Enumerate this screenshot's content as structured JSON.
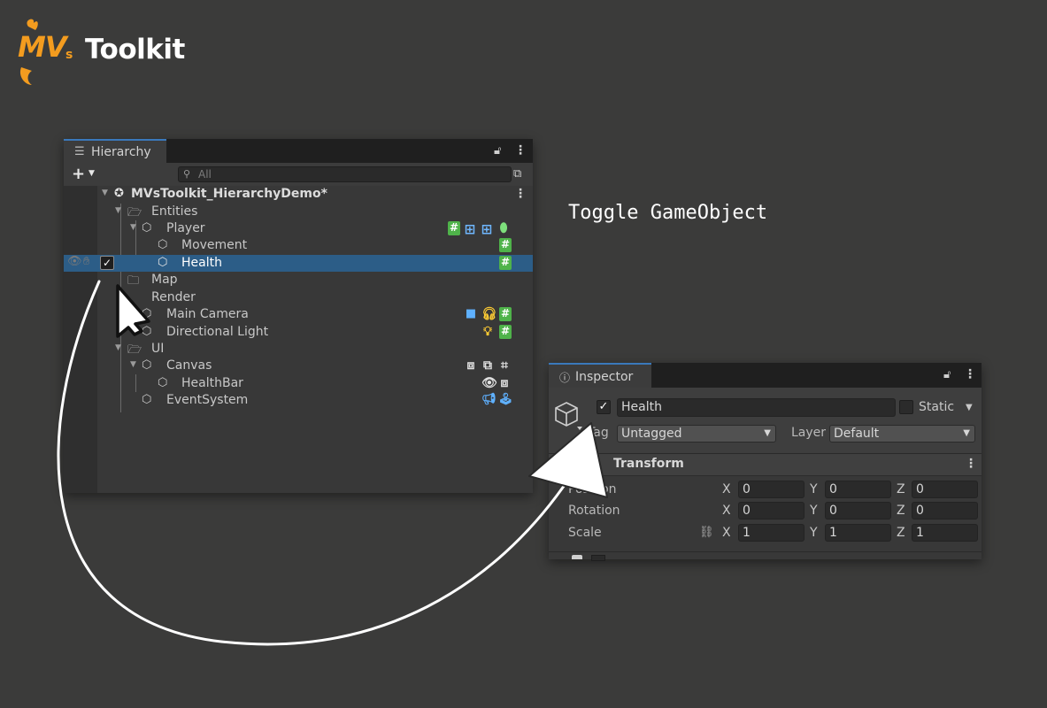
{
  "logo": {
    "mvs": "MV",
    "s": "s",
    "toolkit": "Toolkit"
  },
  "caption": "Toggle GameObject",
  "hierarchy": {
    "tab_label": "Hierarchy",
    "search_placeholder": "All",
    "scene": "MVsToolkit_HierarchyDemo*",
    "rows": {
      "entities": "Entities",
      "player": "Player",
      "movement": "Movement",
      "health": "Health",
      "map": "Map",
      "render": "Render",
      "main_camera": "Main Camera",
      "directional_light": "Directional Light",
      "ui": "UI",
      "canvas": "Canvas",
      "healthbar": "HealthBar",
      "eventsystem": "EventSystem"
    },
    "script_badge": "#"
  },
  "inspector": {
    "tab_label": "Inspector",
    "name_value": "Health",
    "static_label": "Static",
    "tag_label": "Tag",
    "tag_value": "Untagged",
    "layer_label": "Layer",
    "layer_value": "Default",
    "component": "Transform",
    "position_label": "Position",
    "rotation_label": "Rotation",
    "scale_label": "Scale",
    "axis_x": "X",
    "axis_y": "Y",
    "axis_z": "Z",
    "position": [
      "0",
      "0",
      "0"
    ],
    "rotation": [
      "0",
      "0",
      "0"
    ],
    "scale": [
      "1",
      "1",
      "1"
    ]
  },
  "colors": {
    "accent": "#f39c1f",
    "selection": "#2c5d87",
    "script_badge": "#4fb34a"
  }
}
